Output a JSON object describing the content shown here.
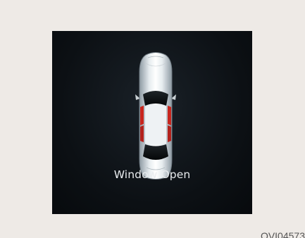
{
  "display": {
    "message": "Window Open",
    "car_icon": "car-top-view-icon",
    "open_windows": [
      "front-left",
      "front-right",
      "rear-left",
      "rear-right"
    ],
    "highlight_color": "#c8261e"
  },
  "caption": {
    "image_code": "OVI04573"
  }
}
